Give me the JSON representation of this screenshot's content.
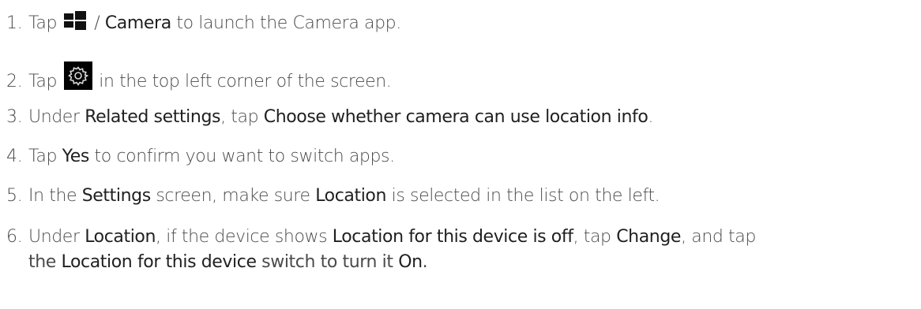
{
  "steps": [
    {
      "num": "1.",
      "t1": "Tap ",
      "t2": " / ",
      "camera": "Camera",
      "t3": " to launch the Camera app."
    },
    {
      "num": "2.",
      "t1": "Tap ",
      "t2": " in the top left corner of the screen."
    },
    {
      "num": "3.",
      "t1": "Under ",
      "related": "Related settings",
      "t2": ", tap ",
      "choose": "Choose whether camera can use location info",
      "t3": "."
    },
    {
      "num": "4.",
      "t1": "Tap ",
      "yes": "Yes",
      "t2": " to confirm you want to switch apps."
    },
    {
      "num": "5.",
      "t1": "In the ",
      "settings": "Settings",
      "t2": " screen, make sure ",
      "location": "Location",
      "t3": " is selected in the list on the left."
    },
    {
      "num": "6.",
      "t1": "Under ",
      "location": "Location",
      "t2": ", if the device shows ",
      "off": "Location for this device is off",
      "t3": ", tap ",
      "change": "Change",
      "t4": ", and tap",
      "l2a": "the ",
      "switch": "Location for this device",
      "l2b": " switch to turn it ",
      "on": "On",
      "l2c": "."
    }
  ]
}
